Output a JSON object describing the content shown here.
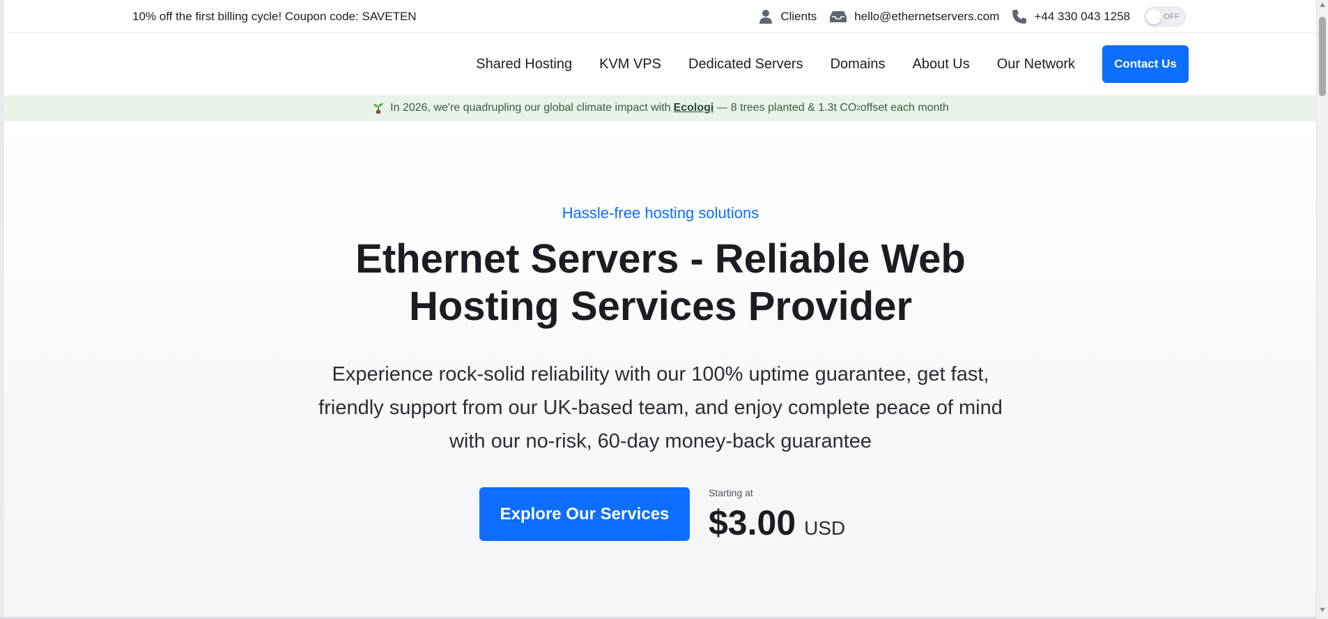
{
  "topbar": {
    "promo": "10% off the first billing cycle! Coupon code: SAVETEN",
    "links": [
      {
        "icon": "user-icon",
        "label": "Clients"
      },
      {
        "icon": "inbox-icon",
        "label": "hello@ethernetservers.com"
      },
      {
        "icon": "phone-icon",
        "label": "+44 330 043 1258"
      }
    ],
    "toggle_label": "OFF"
  },
  "nav": {
    "items": [
      "Shared Hosting",
      "KVM VPS",
      "Dedicated Servers",
      "Domains",
      "About Us",
      "Our Network"
    ],
    "contact_label": "Contact Us"
  },
  "eco_banner": {
    "icon": "sprout-icon",
    "text_before": "In 2026, we're quadrupling our global climate impact with",
    "link": "Ecologi",
    "text_after": "— 8 trees planted & 1.3t CO",
    "subscript": "2",
    "text_end": " offset each month"
  },
  "hero": {
    "eyebrow": "Hassle-free hosting solutions",
    "headline": "Ethernet Servers - Reliable Web Hosting Services Provider",
    "lead": "Experience rock-solid reliability with our 100% uptime guarantee, get fast, friendly support from our UK-based team, and enjoy complete peace of mind with our no-risk, 60-day money-back guarantee",
    "cta_label": "Explore Our Services",
    "starting_label": "Starting at",
    "price": "$3.00",
    "currency": "USD"
  },
  "colors": {
    "accent": "#0d6efd",
    "eco_bg": "#e8f4ea",
    "text": "#1b1d22"
  }
}
